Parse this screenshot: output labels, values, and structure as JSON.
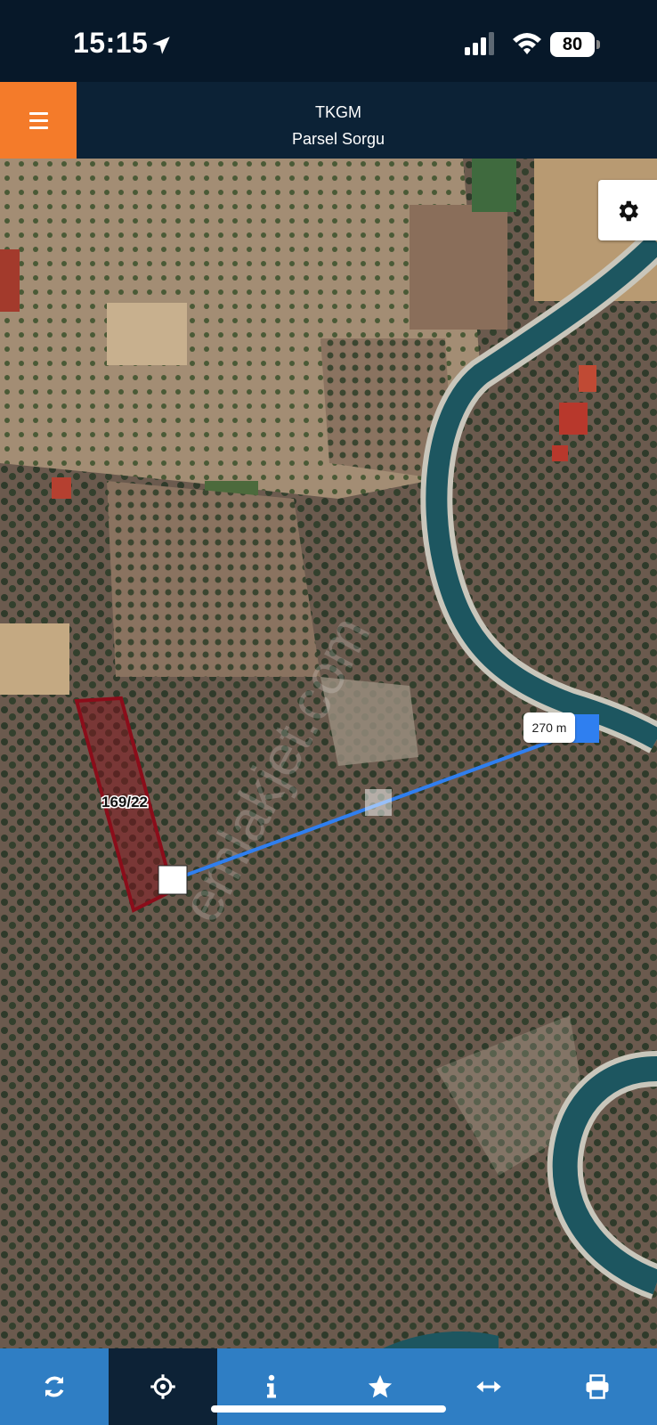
{
  "status_bar": {
    "time": "15:15",
    "battery": "80",
    "icons": [
      "location-arrow-icon",
      "cellular-signal-icon",
      "wifi-icon",
      "battery-icon"
    ]
  },
  "app_bar": {
    "title": "TKGM",
    "subtitle": "Parsel Sorgu",
    "menu_icon": "hamburger-menu-icon",
    "accent_color": "#f47b2a"
  },
  "map": {
    "parcel_label": "169/22",
    "distance_label": "270 m",
    "watermark": "emlakjet.com",
    "parcel_color": "#8b0d1a",
    "measure_line_color": "#2f7ff0"
  },
  "toolbar": {
    "items": [
      {
        "icon": "refresh-icon",
        "active": false
      },
      {
        "icon": "crosshair-icon",
        "active": true
      },
      {
        "icon": "info-icon",
        "active": false
      },
      {
        "icon": "star-icon",
        "active": false
      },
      {
        "icon": "measure-icon",
        "active": false
      },
      {
        "icon": "print-icon",
        "active": false
      }
    ],
    "background": "#2f7ec4",
    "active_background": "#0d2236"
  }
}
